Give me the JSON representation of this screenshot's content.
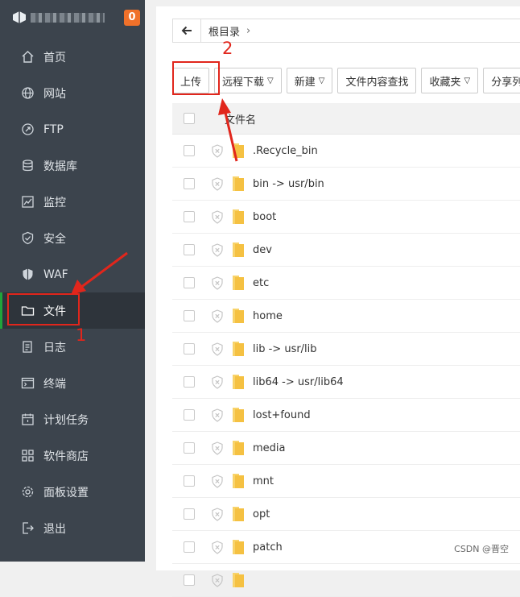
{
  "sidebar": {
    "notification_count": "0",
    "items": [
      {
        "label": "首页",
        "icon": "home-icon"
      },
      {
        "label": "网站",
        "icon": "globe-icon"
      },
      {
        "label": "FTP",
        "icon": "ftp-icon"
      },
      {
        "label": "数据库",
        "icon": "database-icon"
      },
      {
        "label": "监控",
        "icon": "monitor-icon"
      },
      {
        "label": "安全",
        "icon": "shield-check-icon"
      },
      {
        "label": "WAF",
        "icon": "waf-shield-icon"
      },
      {
        "label": "文件",
        "icon": "folder-icon",
        "active": true
      },
      {
        "label": "日志",
        "icon": "log-icon"
      },
      {
        "label": "终端",
        "icon": "terminal-icon"
      },
      {
        "label": "计划任务",
        "icon": "calendar-icon"
      },
      {
        "label": "软件商店",
        "icon": "apps-grid-icon"
      },
      {
        "label": "面板设置",
        "icon": "settings-icon"
      },
      {
        "label": "退出",
        "icon": "logout-icon"
      }
    ]
  },
  "path": {
    "root": "根目录"
  },
  "toolbar": {
    "upload": "上传",
    "remote_download": "远程下载",
    "new": "新建",
    "search_content": "文件内容查找",
    "favorites": "收藏夹",
    "share_list": "分享列表"
  },
  "table": {
    "header_name": "文件名",
    "rows": [
      ".Recycle_bin",
      "bin -> usr/bin",
      "boot",
      "dev",
      "etc",
      "home",
      "lib -> usr/lib",
      "lib64 -> usr/lib64",
      "lost+found",
      "media",
      "mnt",
      "opt",
      "patch",
      ""
    ]
  },
  "annotations": {
    "marker1": "1",
    "marker2": "2"
  },
  "watermark": "CSDN @晋空",
  "colors": {
    "sidebar_bg": "#3c444d",
    "active_bg": "#2e343b",
    "accent_green": "#20a53a",
    "badge_orange": "#f0712a",
    "annotation_red": "#e1261c",
    "folder_yellow": "#f5c142"
  }
}
